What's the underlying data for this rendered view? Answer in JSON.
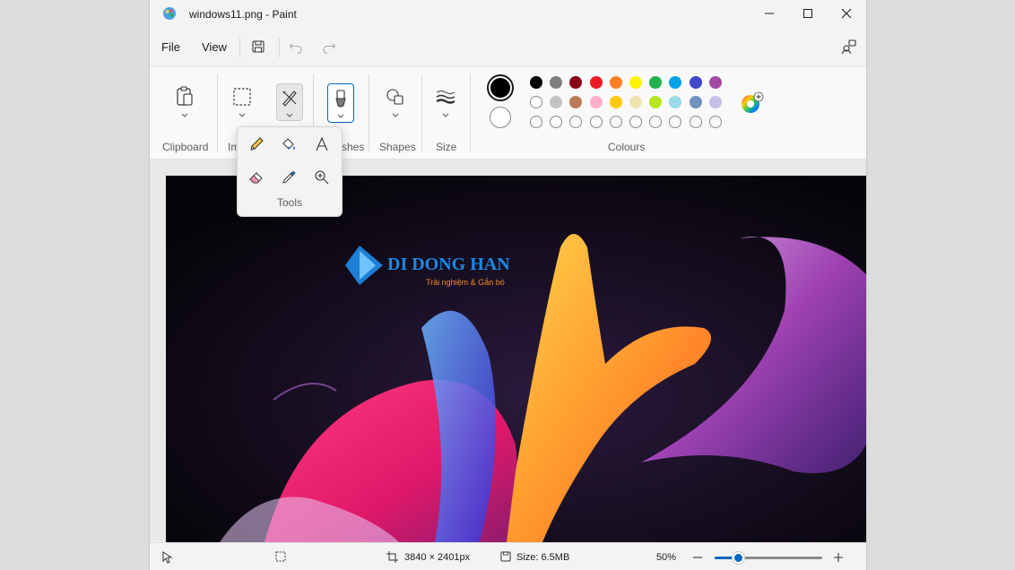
{
  "window": {
    "title": "windows11.png - Paint"
  },
  "menu": {
    "file": "File",
    "view": "View"
  },
  "ribbon": {
    "groups": {
      "clipboard": "Clipboard",
      "image": "Im",
      "brushes": "shes",
      "shapes": "Shapes",
      "size": "Size",
      "colours": "Colours"
    },
    "primary_color": "#000000",
    "secondary_color": "#ffffff",
    "palette_row1": [
      "#000000",
      "#7f7f7f",
      "#880015",
      "#ed1c24",
      "#ff7f27",
      "#fff200",
      "#22b14c",
      "#00a2e8",
      "#3f48cc",
      "#a349a4"
    ],
    "palette_row2": [
      "#ffffff",
      "#c3c3c3",
      "#b97a57",
      "#ffaec9",
      "#ffc90e",
      "#efe4b0",
      "#b5e61d",
      "#99d9ea",
      "#7092be",
      "#c8bfe7"
    ]
  },
  "tools_flyout": {
    "label": "Tools"
  },
  "image": {
    "logo_text": "DI DONG HAN",
    "logo_tagline": "Trải nghiệm & Gắn bó"
  },
  "status": {
    "dimensions": "3840 × 2401px",
    "size": "Size: 6.5MB",
    "zoom": "50%",
    "zoom_level": 0.22
  }
}
